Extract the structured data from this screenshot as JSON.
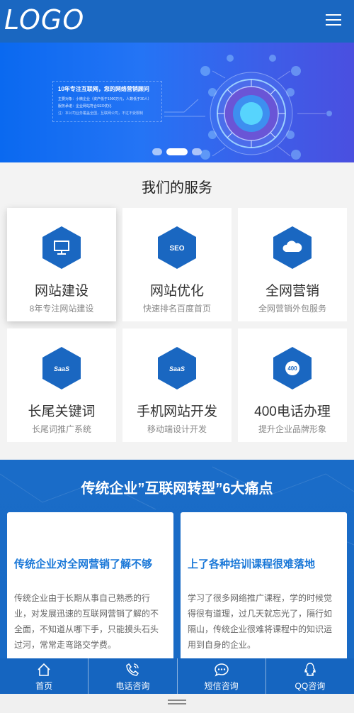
{
  "header": {
    "logo": "LOGO",
    "menu_icon": "hamburger-menu-icon"
  },
  "banner": {
    "title": "10年专注互联网，您的网络营销顾问",
    "lines": [
      "主要对象：小微企业（资产低于1000万元，人数低于30人）",
      "服务承诺：企业网站符合SEO优化",
      "注：本公司业务覆盖全国，互联网公司，不过不受限制"
    ],
    "slides": 3,
    "active_slide": 2
  },
  "services": {
    "title": "我们的服务",
    "items": [
      {
        "title": "网站建设",
        "sub": "8年专注网站建设",
        "icon": "monitor-icon"
      },
      {
        "title": "网站优化",
        "sub": "快速排名百度首页",
        "icon": "seo-icon",
        "icon_text": "SEO"
      },
      {
        "title": "全网营销",
        "sub": "全网营销外包服务",
        "icon": "cloud-icon"
      },
      {
        "title": "长尾关键词",
        "sub": "长尾词推广系统",
        "icon": "saas-icon",
        "icon_text": "SaaS"
      },
      {
        "title": "手机网站开发",
        "sub": "移动端设计开发",
        "icon": "saas-icon",
        "icon_text": "SaaS"
      },
      {
        "title": "400电话办理",
        "sub": "提升企业品牌形象",
        "icon": "400-icon",
        "icon_text": "400"
      }
    ]
  },
  "pain": {
    "title": "传统企业”互联网转型”6大痛点",
    "cards": [
      {
        "heading": "传统企业对全网营销了解不够",
        "text": "传统企业由于长期从事自己熟悉的行业，对发展迅速的互联网营销了解的不全面，不知道从哪下手，只能摸头石头过河，常常走弯路交学费。"
      },
      {
        "heading": "上了各种培训课程很难落地",
        "text": "学习了很多网络推广课程，学的时候觉得很有道理，过几天就忘光了，隔行如隔山，传统企业很难将课程中的知识运用到自身的企业。"
      }
    ]
  },
  "bottom_nav": [
    {
      "label": "首页",
      "icon": "home-icon"
    },
    {
      "label": "电话咨询",
      "icon": "phone-icon"
    },
    {
      "label": "短信咨询",
      "icon": "message-icon"
    },
    {
      "label": "QQ咨询",
      "icon": "qq-icon"
    }
  ],
  "colors": {
    "primary": "#1a67c1",
    "accent_text": "#1a78d8",
    "nav_bg": "#1565c0"
  }
}
